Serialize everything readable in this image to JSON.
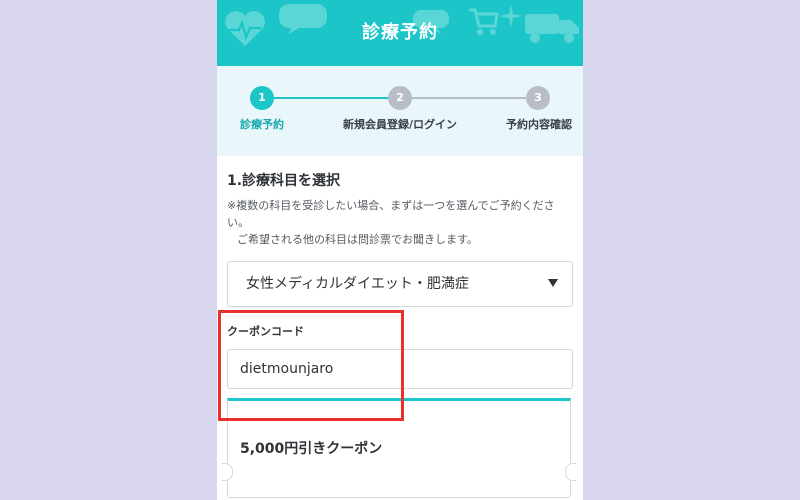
{
  "header": {
    "title": "診療予約",
    "background_color": "#1cc6c8"
  },
  "steps": [
    {
      "number": "1",
      "label": "診療予約",
      "active": true
    },
    {
      "number": "2",
      "label": "新規会員登録/ログイン",
      "active": false
    },
    {
      "number": "3",
      "label": "予約内容確認",
      "active": false
    }
  ],
  "section": {
    "title": "1.診療科目を選択",
    "note_line1": "※複数の科目を受診したい場合、まずは一つを選んでご予約ください。",
    "note_line2": "ご希望される他の科目は問診票でお聞きします。"
  },
  "department_select": {
    "value": "女性メディカルダイエット・肥満症"
  },
  "coupon": {
    "label": "クーポンコード",
    "value": "dietmounjaro",
    "card_title": "5,000円引きクーポン"
  },
  "colors": {
    "accent": "#1cc6c8",
    "highlight": "#e8312b",
    "page_background": "#d7d6ec"
  }
}
